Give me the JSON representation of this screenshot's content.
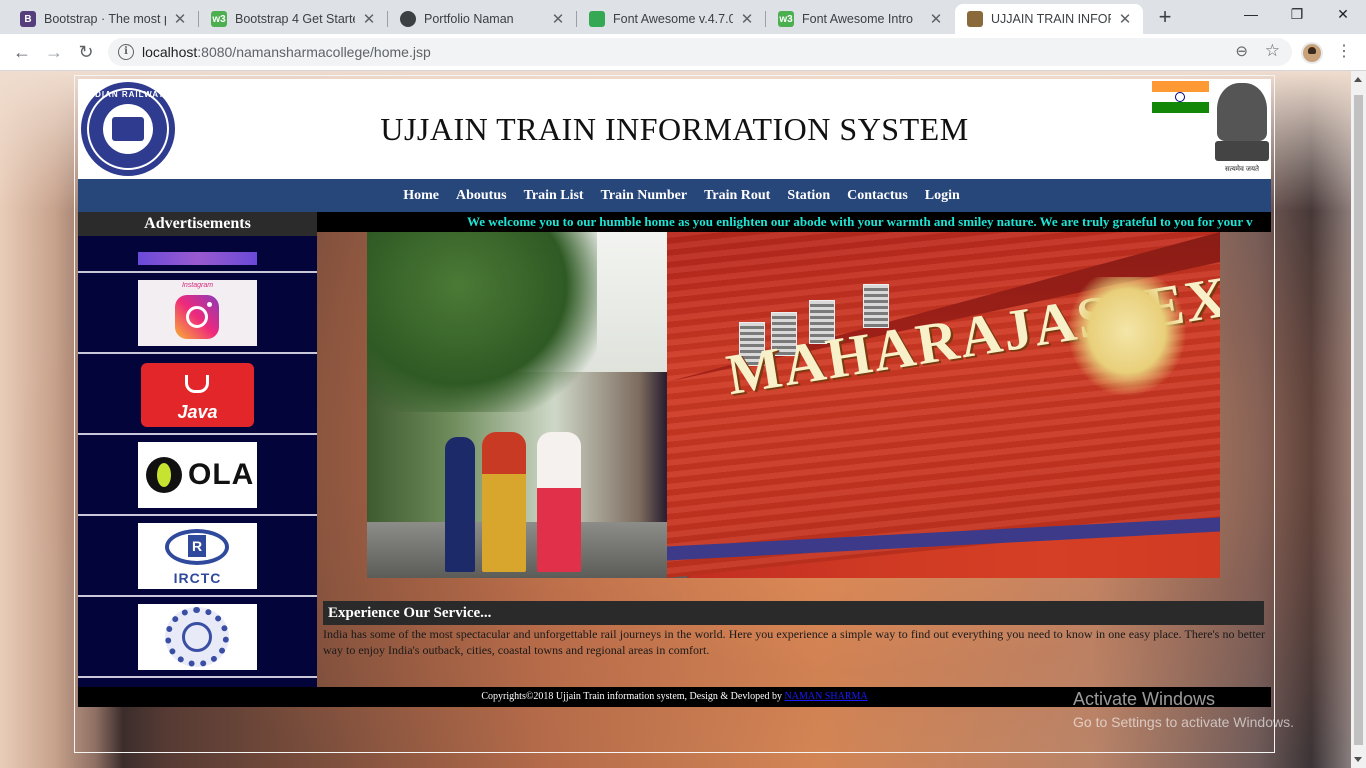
{
  "browser": {
    "tabs": [
      {
        "title": "Bootstrap · The most po",
        "fav_letter": "B",
        "fav_color": "#563d7c",
        "active": false
      },
      {
        "title": "Bootstrap 4 Get Started",
        "fav_letter": "w3",
        "fav_color": "#4caf50",
        "active": false
      },
      {
        "title": "Portfolio Naman",
        "fav_letter": "",
        "fav_color": "#3c4043",
        "active": false
      },
      {
        "title": "Font Awesome v.4.7.0 |",
        "fav_letter": "",
        "fav_color": "#34a853",
        "active": false
      },
      {
        "title": "Font Awesome Intro",
        "fav_letter": "w3",
        "fav_color": "#4caf50",
        "active": false
      },
      {
        "title": "UJJAIN TRAIN INFORMA",
        "fav_letter": "",
        "fav_color": "#8a6a3a",
        "active": true
      }
    ],
    "new_tab": "+",
    "window_controls": {
      "minimize": "—",
      "maximize": "❐",
      "close": "✕"
    },
    "url_host": "localhost",
    "url_path": ":8080/namansharmacollege/home.jsp",
    "icons": {
      "back": "back-arrow-icon",
      "forward": "forward-arrow-icon",
      "reload": "reload-icon",
      "info": "info-icon",
      "zoom": "zoom-icon",
      "star": "star-icon",
      "menu": "menu-icon"
    }
  },
  "site": {
    "logo_text": "INDIAN RAILWAYS",
    "title": "UJJAIN TRAIN INFORMATION SYSTEM",
    "emblem_motto": "सत्यमेव जयते",
    "nav": [
      "Home",
      "Aboutus",
      "Train List",
      "Train Number",
      "Train Rout",
      "Station",
      "Contactus",
      "Login"
    ],
    "sidebar_heading": "Advertisements",
    "ads": [
      {
        "name": "trainman-ad"
      },
      {
        "name": "instagram-ad",
        "label": "Instagram"
      },
      {
        "name": "java-ad",
        "label": "Java"
      },
      {
        "name": "ola-ad",
        "label": "OLA"
      },
      {
        "name": "irctc-ad",
        "label": "IRCTC"
      },
      {
        "name": "ipl-ad",
        "label": "IPL"
      }
    ],
    "ticker": "We welcome you to our humble home as you enlighten our abode with your warmth and smiley nature. We are truly grateful to you for your v",
    "hero_brand": "MAHARAJAS' EXPRESS",
    "service_heading": "Experience Our Service...",
    "service_text": "India has some of the most spectacular and unforgettable rail journeys in the world. Here you experience a simple way to find out everything you need to know in one easy place. There's no better way to enjoy India's outback, cities, coastal towns and regional areas in comfort.",
    "footer_prefix": "Copyrights©2018 Ujjain Train information system, Design & Devloped by ",
    "footer_author": "NAMAN SHARMA"
  },
  "os": {
    "watermark_line1": "Activate Windows",
    "watermark_line2": "Go to Settings to activate Windows."
  },
  "colors": {
    "navbar": "#27467a",
    "sidebar": "#03043a",
    "ticker_text": "#1fe3d4",
    "footer_link": "#1a1aff"
  }
}
